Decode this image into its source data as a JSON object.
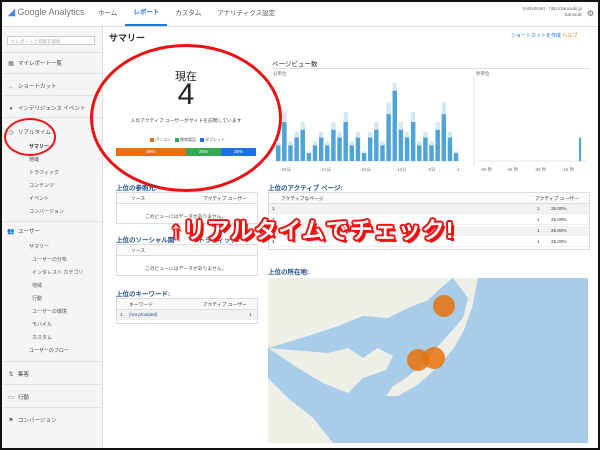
{
  "header": {
    "logo_text": "Google Analytics",
    "nav": [
      "ホーム",
      "レポート",
      "カスタム",
      "アナリティクス設定"
    ],
    "active_nav": "レポート",
    "account_line1": "SARUSUKI - http://sarusuki.jp",
    "account_line2": "Sarusuki"
  },
  "sidebar": {
    "search_placeholder": "レポートと移動を検索",
    "items": [
      {
        "label": "マイレポート一覧",
        "icon": "grid-icon"
      },
      {
        "label": "ショートカット",
        "icon": "arrow-icon"
      },
      {
        "label": "インテリジェンス イベント",
        "icon": "bulb-icon"
      },
      {
        "label": "リアルタイム",
        "icon": "clock-icon"
      }
    ],
    "realtime_sub": [
      "サマリー",
      "地域",
      "トラフィック",
      "コンテンツ",
      "イベント",
      "コンバージョン"
    ],
    "users_label": "ユーザー",
    "users_sub": [
      "サマリー",
      "ユーザーの分布",
      "インタレスト カテゴリ",
      "地域",
      "行動",
      "ユーザーの環境",
      "モバイル",
      "カスタム",
      "ユーザーのフロー"
    ],
    "bottom_items": [
      {
        "label": "集客",
        "icon": "acquisition-icon"
      },
      {
        "label": "行動",
        "icon": "behavior-icon"
      },
      {
        "label": "コンバージョン",
        "icon": "flag-icon"
      }
    ]
  },
  "main": {
    "title": "サマリー",
    "shortcut": "ショートカットを作成",
    "help": "ヘルプ"
  },
  "realtime": {
    "now_label": "現在",
    "active_users": "4",
    "caption": "人のアクティブ ユーザーがサイトを訪問しています",
    "legend": [
      "パソコン",
      "携帯電話",
      "タブレット"
    ],
    "device_share": [
      {
        "label": "50%",
        "fraction": 0.5,
        "color": "#e8710a"
      },
      {
        "label": "25%",
        "fraction": 0.25,
        "color": "#34a853"
      },
      {
        "label": "25%",
        "fraction": 0.25,
        "color": "#1a73e8"
      }
    ]
  },
  "pageviews": {
    "title": "ページビュー数",
    "per_minute": "分単位",
    "per_second": "秒単位",
    "minute_ticks": [
      "-26分",
      "-21分",
      "-16分",
      "-11分",
      "-6分",
      "-1"
    ],
    "second_ticks": [
      "-60 秒",
      "-45 秒",
      "-30 秒",
      "-15 秒"
    ]
  },
  "chart_data": {
    "type": "bar",
    "title": "ページビュー数",
    "x": [
      "-30",
      "-29",
      "-28",
      "-27",
      "-26",
      "-25",
      "-24",
      "-23",
      "-22",
      "-21",
      "-20",
      "-19",
      "-18",
      "-17",
      "-16",
      "-15",
      "-14",
      "-13",
      "-12",
      "-11",
      "-10",
      "-9",
      "-8",
      "-7",
      "-6",
      "-5",
      "-4",
      "-3",
      "-2",
      "-1"
    ],
    "values": [
      2,
      5,
      2,
      3,
      4,
      1,
      2,
      3,
      2,
      4,
      3,
      5,
      2,
      3,
      1,
      3,
      4,
      2,
      6,
      9,
      4,
      3,
      5,
      2,
      3,
      2,
      4,
      6,
      3,
      1
    ],
    "ylim": [
      0,
      10
    ],
    "seconds_values": [
      0,
      0,
      0,
      0,
      0,
      0,
      0,
      0,
      0,
      0,
      0,
      0,
      0,
      0,
      0,
      0,
      0,
      0,
      0,
      0,
      0,
      0,
      0,
      0,
      0,
      0,
      0,
      0,
      1,
      0
    ],
    "bar_color": "#4fa3d8"
  },
  "referrers": {
    "title": "上位の参照元:",
    "col_source": "ソース",
    "col_users": "アクティブ ユーザー",
    "empty": "このビューにはデータがありません。"
  },
  "social": {
    "title": "上位のソーシャル関",
    "title_tail": "トラフィック:",
    "col_source": "ソース",
    "empty": "このビューにはデータがありません。"
  },
  "keywords": {
    "title": "上位のキーワード:",
    "col_keyword": "キーワード",
    "col_users": "アクティブ ユーザー",
    "rows": [
      {
        "num": "1.",
        "keyword": "(not provided)",
        "users": "1"
      }
    ]
  },
  "active_pages": {
    "title": "上位のアクティブ ページ:",
    "col_page": "アクティブなページ",
    "col_users": "アクティブ ユーザー",
    "rows": [
      {
        "num": "1.",
        "users": "1",
        "pct": "25.00%"
      },
      {
        "num": "2.",
        "users": "1",
        "pct": "25.00%"
      },
      {
        "num": "3.",
        "users": "1",
        "pct": "25.00%"
      },
      {
        "num": "4.",
        "users": "1",
        "pct": "25.00%"
      }
    ]
  },
  "locations": {
    "title": "上位の所在地:"
  },
  "overlay": {
    "text": "↑リアルタイムでチェック!",
    "color": "#e11111"
  }
}
